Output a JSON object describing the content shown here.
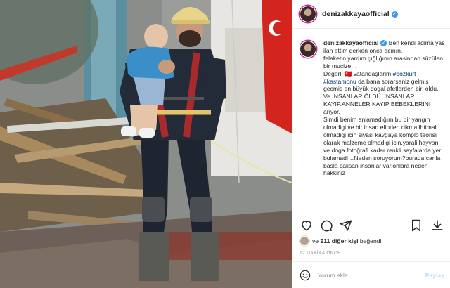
{
  "post": {
    "username": "denizakkayaofficial",
    "caption_username": "denizakkayaofficial",
    "caption_parts": [
      {
        "type": "text",
        "text": " Ben kendi adima yas ilan ettim derken onca acının, felaketin,yardım çığlığının arasindan süzülen bir mucize…"
      },
      {
        "type": "text",
        "text": "Degerli 🇹🇷 vatandaşlarim "
      },
      {
        "type": "tag",
        "text": "#bozkurt"
      },
      {
        "type": "text",
        "text": " "
      },
      {
        "type": "tag",
        "text": "#kastamonu"
      },
      {
        "type": "text",
        "text": " da bana sorarsaniz gelmis gecmis en büyük dogal afetlerden biri oldu. Ve INSANLAR ÖLDÜ. INSANLAR KAYIP.ANNELER KAYIP BEBEKLERINI arıyor."
      },
      {
        "type": "text",
        "text": "Simdi benim anlamadığım bu bir yangın olmadigi ve bir insan elinden cikma ihtimali olmadigi icin siyasi kavgaya komplo teorisi olarak malzeme olmadigi icin,yarali hayvan ve doga fotoğrafi kadar renkli sayfalarda yer bulamadi…Neden soruyorum?burada canla basla calisan insanlar var.onlara neden hakkiniz"
      }
    ],
    "likes_prefix": "ve",
    "likes_count": "911 diğer kişi",
    "likes_suffix": "beğendi",
    "time_ago": "12 DAKİKA ÖNCE",
    "comment_placeholder": "Yorum ekle...",
    "share_label": "Paylaş",
    "colors": {
      "verified": "#3897f0",
      "hashtag": "#00376b",
      "muted": "#8e8e8e",
      "share_disabled": "#b2dffc"
    },
    "icons": [
      "heart-icon",
      "comment-icon",
      "send-icon",
      "bookmark-icon",
      "download-icon",
      "emoji-icon",
      "more-icon",
      "verified-icon"
    ]
  }
}
